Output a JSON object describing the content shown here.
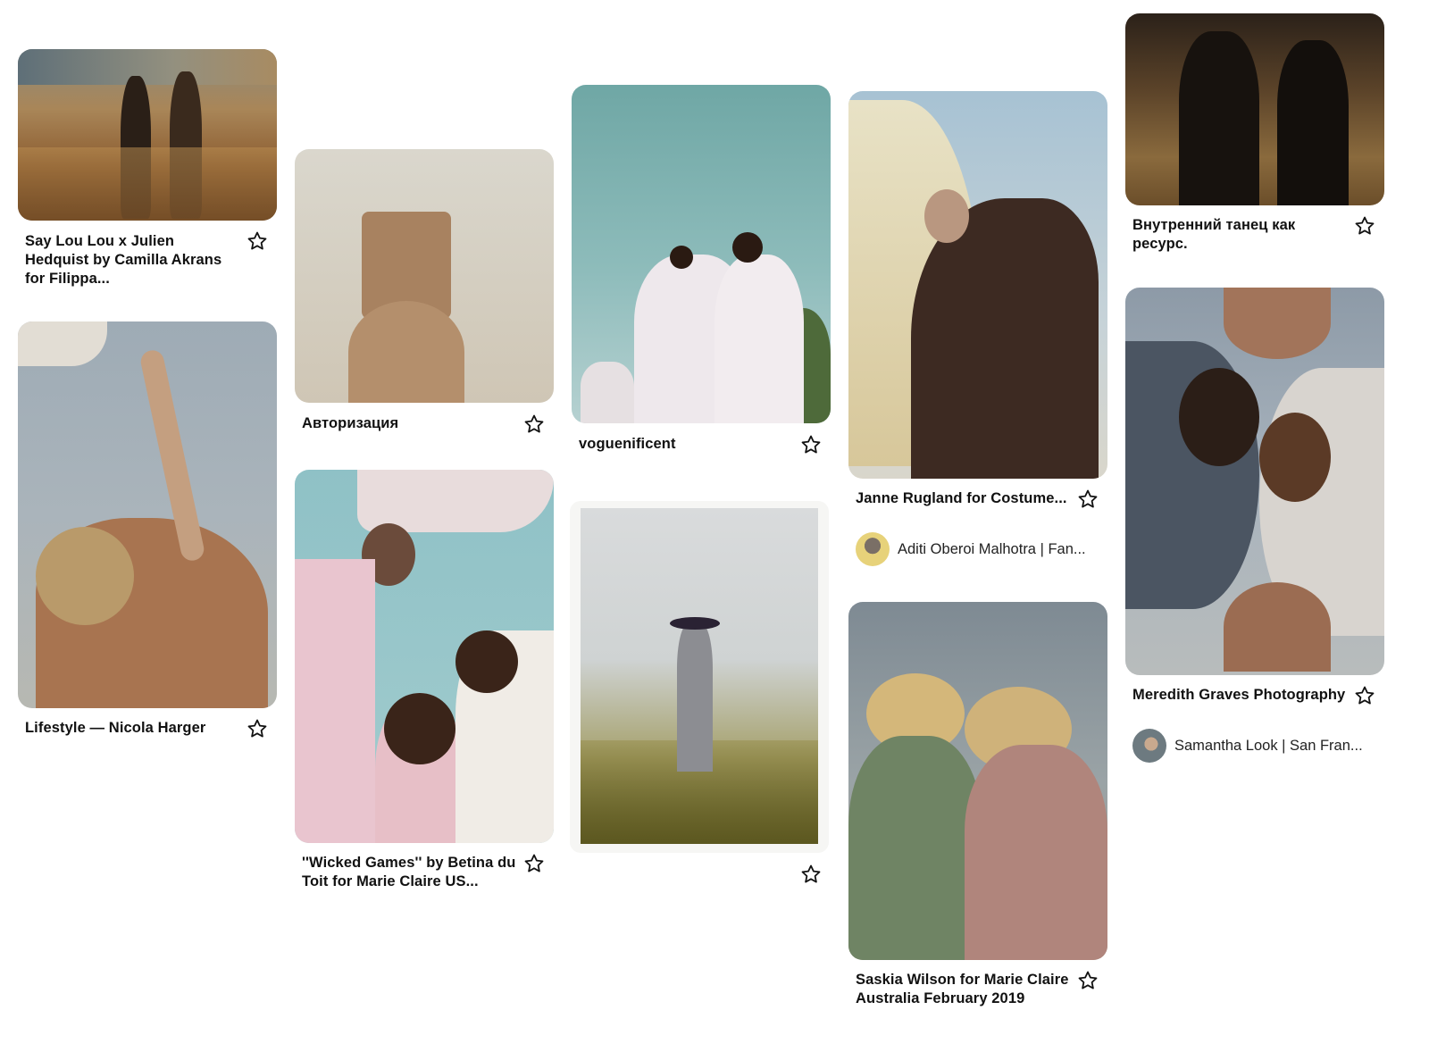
{
  "pins": [
    {
      "title": "Say Lou Lou x Julien Hedquist by Camilla Akrans for Filippa..."
    },
    {
      "title": "Lifestyle — Nicola Harger"
    },
    {
      "title": "Авторизация"
    },
    {
      "title": "''Wicked Games'' by Betina du Toit for Marie Claire US..."
    },
    {
      "title": "voguenificent"
    },
    {
      "title": ""
    },
    {
      "title": "Janne Rugland for Costume...",
      "author": "Aditi Oberoi Malhotra | Fan..."
    },
    {
      "title": "Saskia Wilson for Marie Claire Australia February 2019"
    },
    {
      "title": "Внутренний танец как ресурс."
    },
    {
      "title": "Meredith Graves Photography",
      "author": "Samantha Look | San Fran..."
    }
  ],
  "icons": {
    "save": "star-outline-icon",
    "avatar": "user-avatar"
  },
  "colors": {
    "background": "#ffffff",
    "text": "#111111"
  }
}
